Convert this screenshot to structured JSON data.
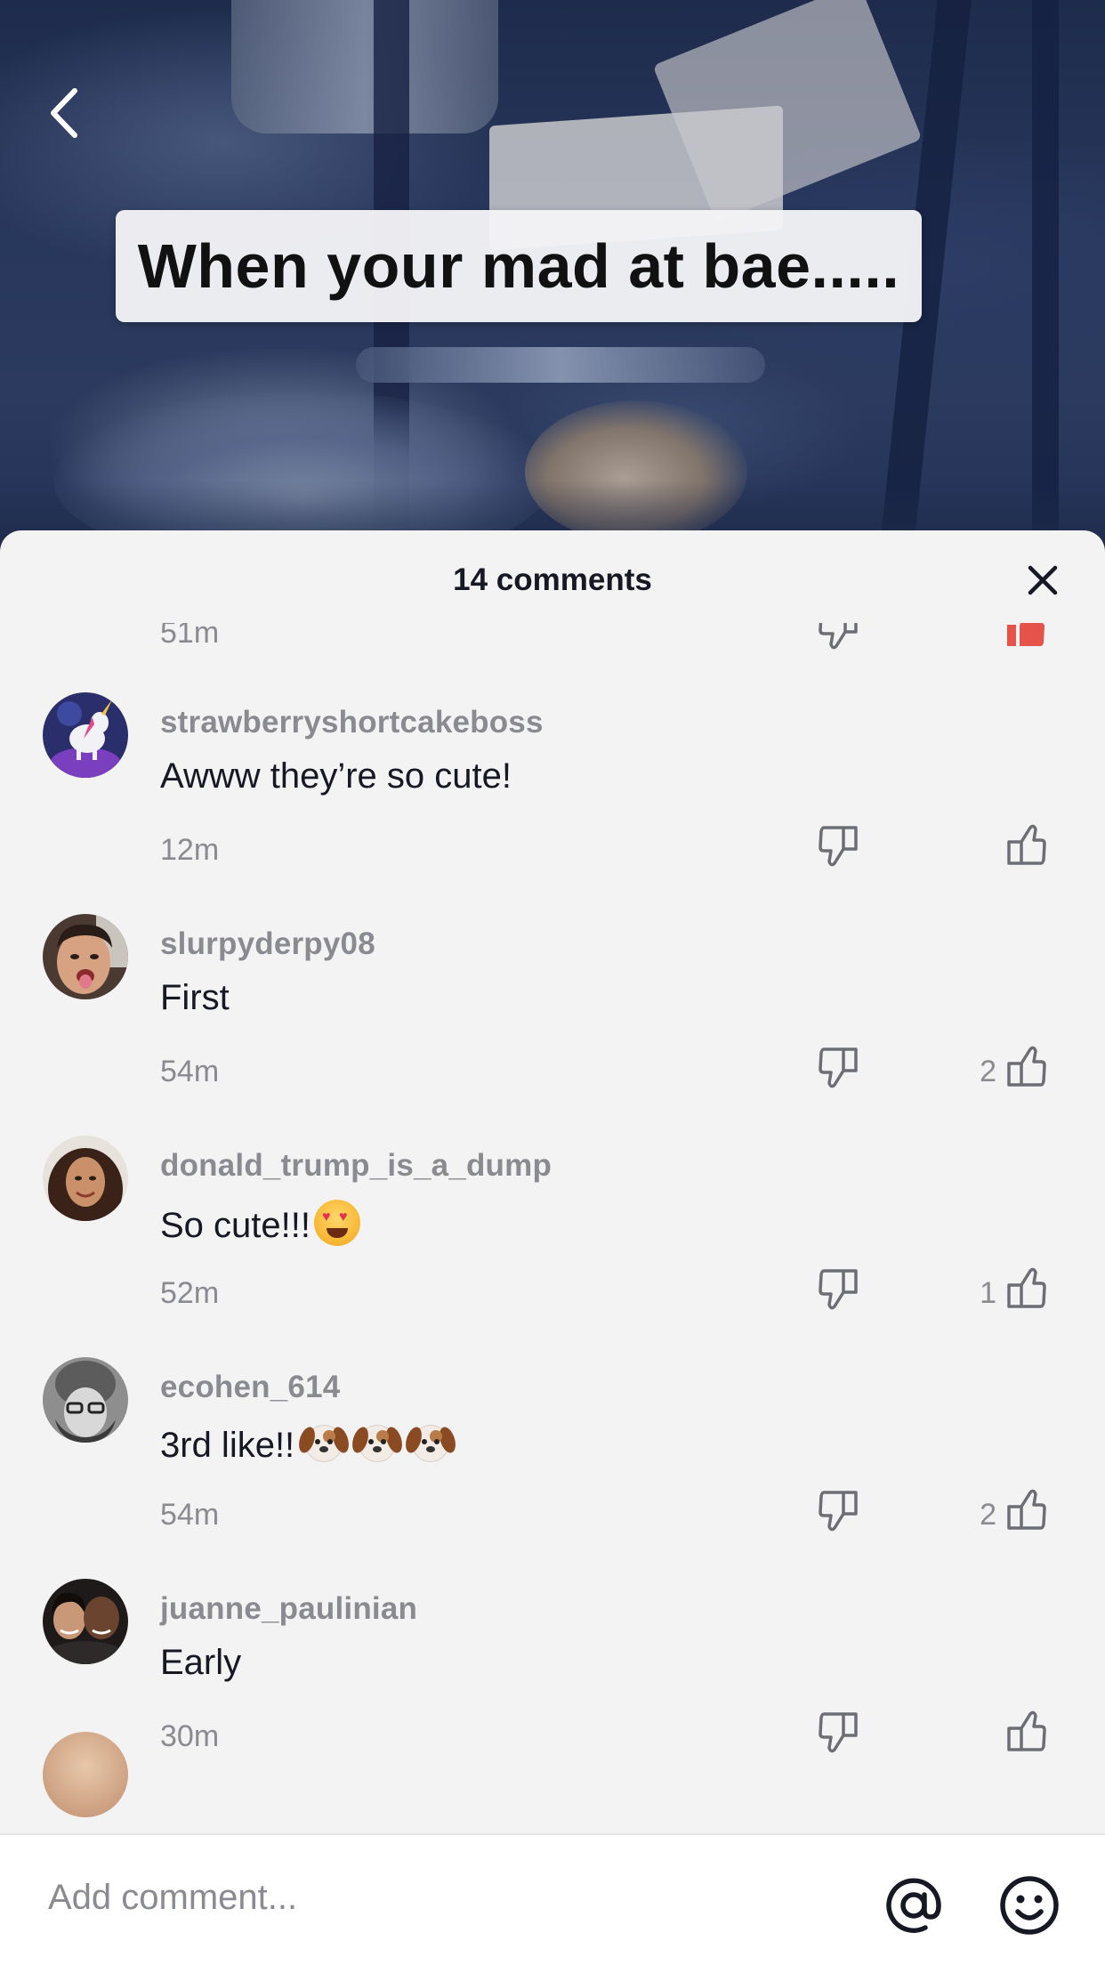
{
  "video": {
    "caption": "When your mad at bae....."
  },
  "sheet": {
    "title": "14 comments",
    "partial_top": {
      "time": "51m"
    },
    "comments": [
      {
        "username": "strawberryshortcakeboss",
        "text": "Awww they’re so cute!",
        "time": "12m",
        "likes": ""
      },
      {
        "username": "slurpyderpy08",
        "text": "First",
        "time": "54m",
        "likes": "2"
      },
      {
        "username": "donald_trump_is_a_dump",
        "text": "So cute!!!",
        "time": "52m",
        "likes": "1"
      },
      {
        "username": "ecohen_614",
        "text": "3rd like!!",
        "time": "54m",
        "likes": "2"
      },
      {
        "username": "juanne_paulinian",
        "text": "Early",
        "time": "30m",
        "likes": ""
      }
    ]
  },
  "input": {
    "placeholder": "Add comment..."
  },
  "icons": {
    "back": "chevron-left-icon",
    "close": "close-icon",
    "dislike": "thumbs-down-icon",
    "like": "thumbs-up-icon",
    "mention": "at-sign-icon",
    "emoji": "smiley-icon"
  },
  "colors": {
    "accent_red": "#e5534b",
    "text_primary": "#161823",
    "text_secondary": "#8a8b91",
    "sheet_bg": "#f4f3f4"
  }
}
